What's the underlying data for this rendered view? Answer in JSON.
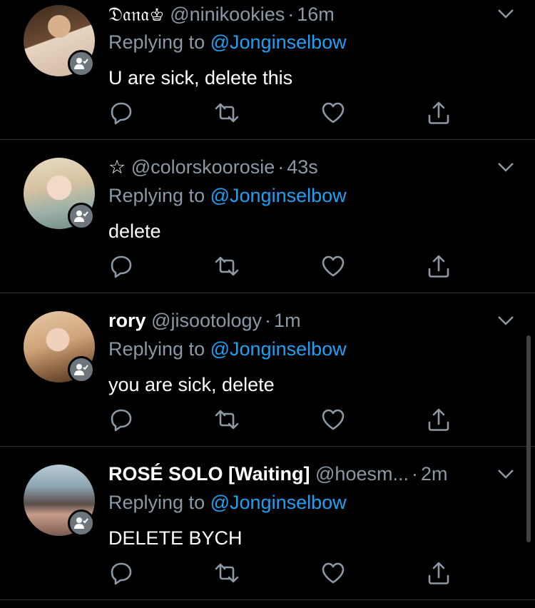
{
  "tweets": [
    {
      "name": "𝔇𝔞𝔫𝔞♔",
      "handle": "@ninikookies",
      "sep": "·",
      "time": "16m",
      "replying_label": "Replying to",
      "replying_to": "@Jonginselbow",
      "text": "U are sick, delete this"
    },
    {
      "name": "☆",
      "handle": "@colorskoorosie",
      "sep": "·",
      "time": "43s",
      "replying_label": "Replying to",
      "replying_to": "@Jonginselbow",
      "text": "delete"
    },
    {
      "name": "rory",
      "handle": "@jisootology",
      "sep": "·",
      "time": "1m",
      "replying_label": "Replying to",
      "replying_to": "@Jonginselbow",
      "text": "you are sick, delete"
    },
    {
      "name": "ROSÉ SOLO [Waiting]",
      "handle": "@hoesm...",
      "sep": "·",
      "time": "2m",
      "replying_label": "Replying to",
      "replying_to": "@Jonginselbow",
      "text": "DELETE BYCH"
    }
  ],
  "icons": {
    "reply": "reply-icon",
    "retweet": "retweet-icon",
    "like": "heart-icon",
    "share": "share-icon",
    "more": "chevron-down-icon",
    "badge": "follower-badge-icon"
  },
  "colors": {
    "background": "#000000",
    "link": "#1da1f2",
    "muted": "#8b98a5",
    "divider": "#2f3336",
    "icon": "#8b98a5"
  }
}
